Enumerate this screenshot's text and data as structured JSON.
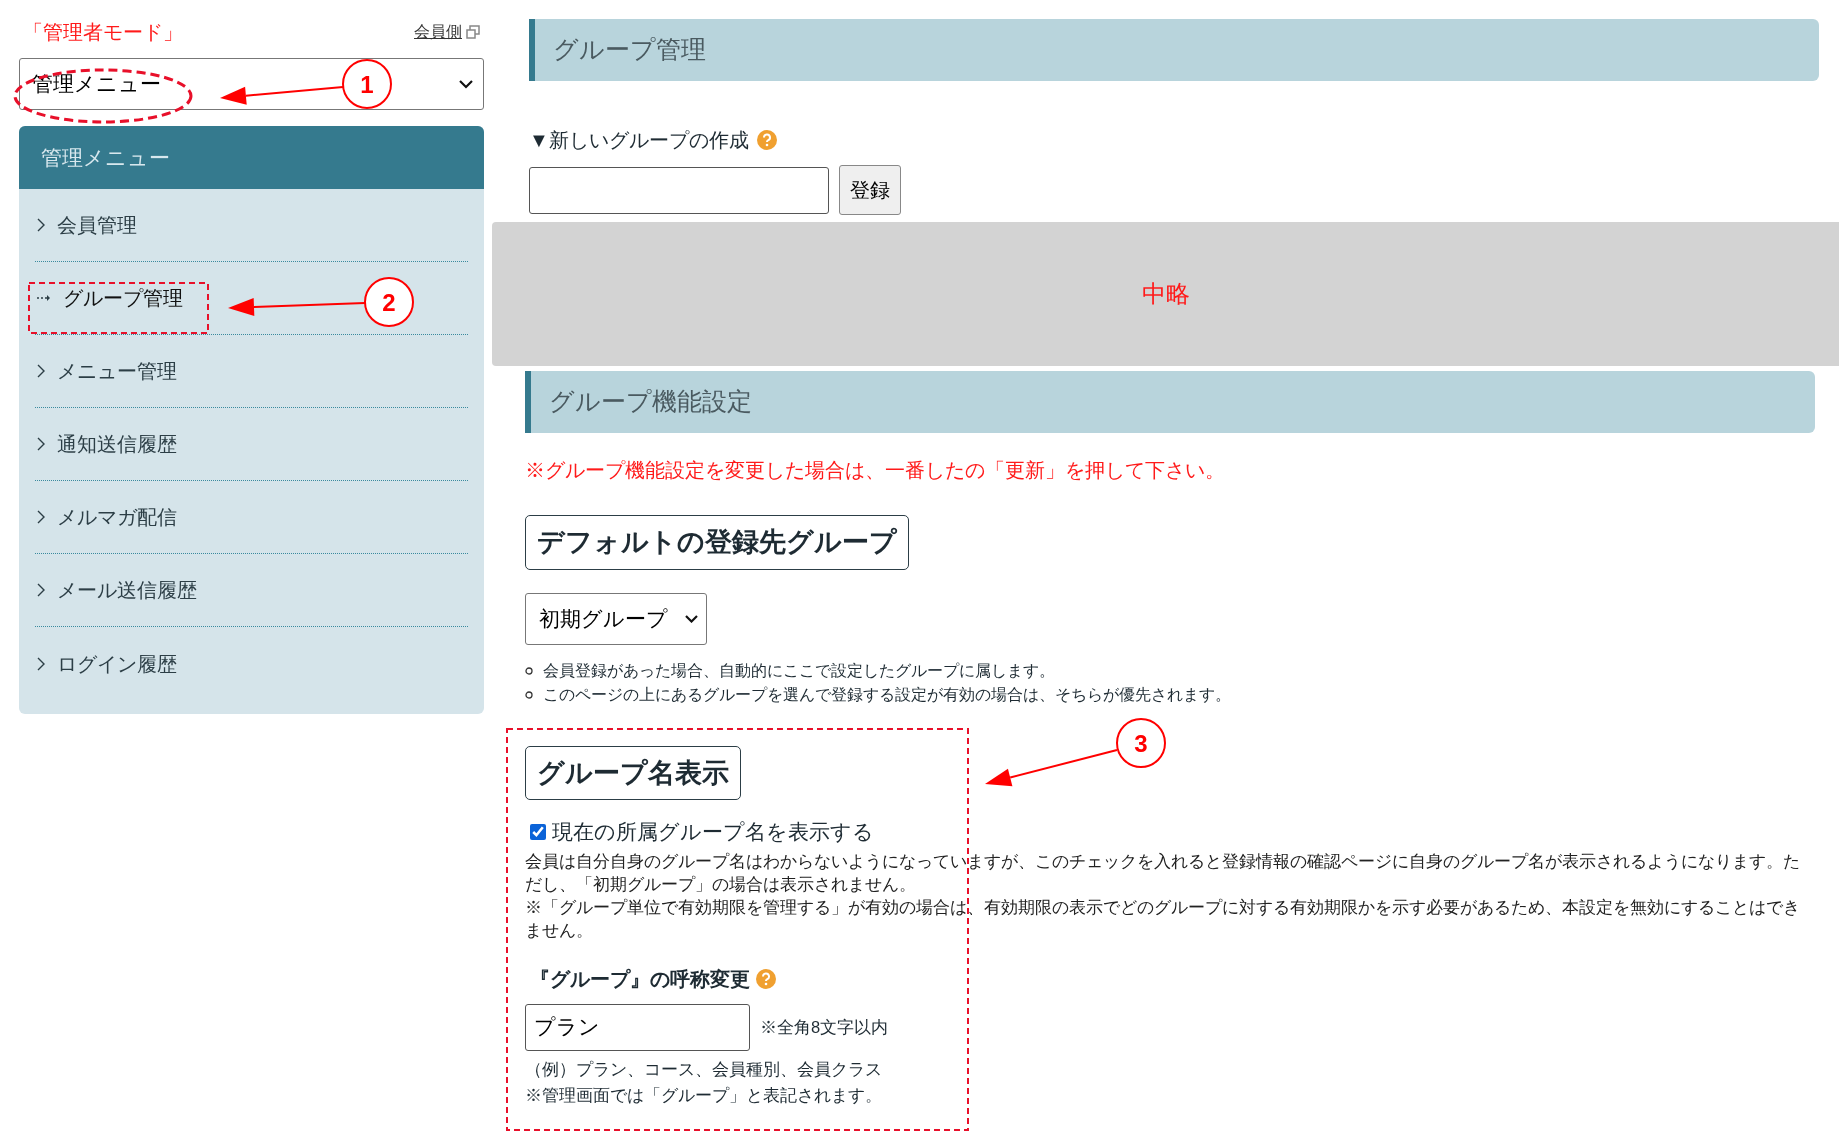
{
  "mode_label": "「管理者モード」",
  "member_link": "会員側",
  "menu_select": {
    "value": "管理メニュー"
  },
  "sidebar": {
    "title": "管理メニュー",
    "items": [
      {
        "label": "会員管理",
        "selected": false
      },
      {
        "label": "グループ管理",
        "selected": true
      },
      {
        "label": "メニュー管理",
        "selected": false
      },
      {
        "label": "通知送信履歴",
        "selected": false
      },
      {
        "label": "メルマガ配信",
        "selected": false
      },
      {
        "label": "メール送信履歴",
        "selected": false
      },
      {
        "label": "ログイン履歴",
        "selected": false
      }
    ]
  },
  "page_title": "グループ管理",
  "new_group": {
    "label": "▼新しいグループの作成",
    "button": "登録"
  },
  "omitted_label": "中略",
  "settings": {
    "title": "グループ機能設定",
    "notice": "※グループ機能設定を変更した場合は、一番したの「更新」を押して下さい。",
    "default_group": {
      "heading": "デフォルトの登録先グループ",
      "select": "初期グループ",
      "notes": [
        "会員登録があった場合、自動的にここで設定したグループに属します。",
        "このページの上にあるグループを選んで登録する設定が有効の場合は、そちらが優先されます。"
      ]
    },
    "display": {
      "heading": "グループ名表示",
      "checkbox": {
        "label": "現在の所属グループ名を表示する",
        "checked": true
      },
      "paragraphs": [
        "会員は自分自身のグループ名はわからないようになっていますが、このチェックを入れると登録情報の確認ページに自身のグループ名が表示されるようになります。ただし、「初期グループ」の場合は表示されません。",
        "※「グループ単位で有効期限を管理する」が有効の場合は、有効期限の表示でどのグループに対する有効期限かを示す必要があるため、本設定を無効にすることはできません。"
      ]
    },
    "rename": {
      "heading": "『グループ』の呼称変更",
      "value": "プラン",
      "limit": "※全角8文字以内",
      "example": "（例）プラン、コース、会員種別、会員クラス",
      "note": "※管理画面では「グループ」と表記されます。"
    }
  },
  "annotations": [
    {
      "number": "1"
    },
    {
      "number": "2"
    },
    {
      "number": "3"
    }
  ]
}
